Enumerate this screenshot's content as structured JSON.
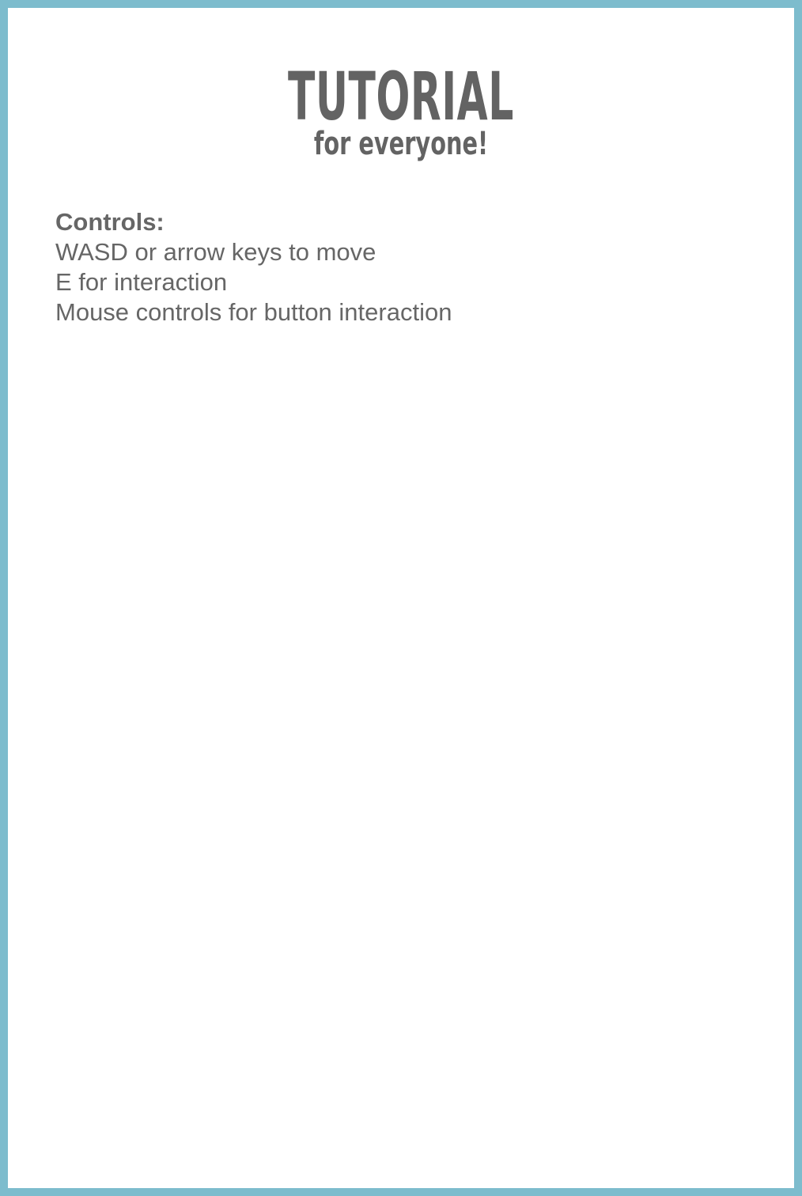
{
  "tutorial": {
    "title": "TUTORIAL",
    "subtitle": "for everyone!"
  },
  "controls": {
    "heading": "Controls:",
    "lines": [
      "WASD or arrow keys to move",
      "E for interaction",
      "Mouse controls for button interaction"
    ]
  },
  "colors": {
    "border": "#7dbccd",
    "background": "#ffffff",
    "text": "#636363"
  }
}
